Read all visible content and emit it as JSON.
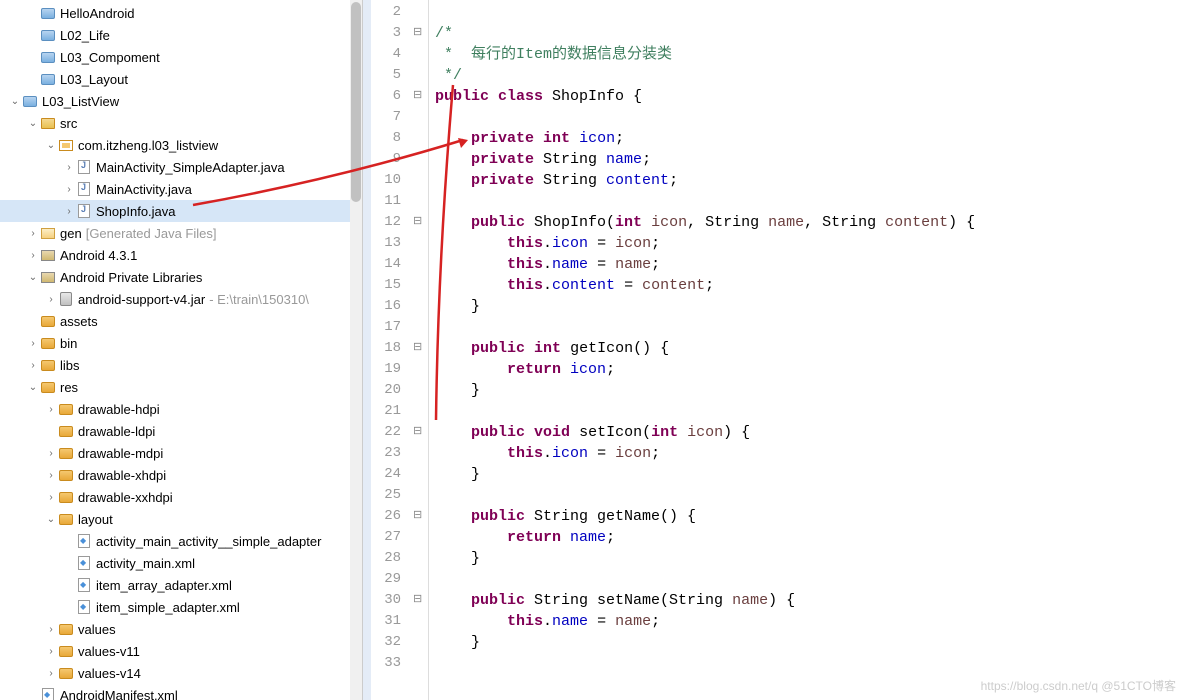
{
  "tree": {
    "items": [
      {
        "indent": 1,
        "arrow": "none",
        "icon": "ic-folder-blue",
        "label": "HelloAndroid"
      },
      {
        "indent": 1,
        "arrow": "none",
        "icon": "ic-folder-blue",
        "label": "L02_Life"
      },
      {
        "indent": 1,
        "arrow": "none",
        "icon": "ic-folder-blue",
        "label": "L03_Compoment"
      },
      {
        "indent": 1,
        "arrow": "none",
        "icon": "ic-folder-blue",
        "label": "L03_Layout"
      },
      {
        "indent": 0,
        "arrow": "open",
        "icon": "ic-folder-blue",
        "label": "L03_ListView"
      },
      {
        "indent": 1,
        "arrow": "open",
        "icon": "ic-src",
        "label": "src"
      },
      {
        "indent": 2,
        "arrow": "open",
        "icon": "ic-pkg",
        "label": "com.itzheng.l03_listview"
      },
      {
        "indent": 3,
        "arrow": "closed",
        "icon": "ic-java",
        "label": "MainActivity_SimpleAdapter.java"
      },
      {
        "indent": 3,
        "arrow": "closed",
        "icon": "ic-java",
        "label": "MainActivity.java"
      },
      {
        "indent": 3,
        "arrow": "closed",
        "icon": "ic-java",
        "label": "ShopInfo.java",
        "selected": true
      },
      {
        "indent": 1,
        "arrow": "closed",
        "icon": "ic-gen",
        "label": "gen",
        "extra": "[Generated Java Files]",
        "extraColor": "gray"
      },
      {
        "indent": 1,
        "arrow": "closed",
        "icon": "ic-lib",
        "label": "Android 4.3.1"
      },
      {
        "indent": 1,
        "arrow": "open",
        "icon": "ic-lib",
        "label": "Android Private Libraries"
      },
      {
        "indent": 2,
        "arrow": "closed",
        "icon": "ic-jar",
        "label": "android-support-v4.jar",
        "extra": " - E:\\train\\150310\\",
        "extraGray": true
      },
      {
        "indent": 1,
        "arrow": "none",
        "icon": "ic-folder",
        "label": "assets"
      },
      {
        "indent": 1,
        "arrow": "closed",
        "icon": "ic-folder",
        "label": "bin"
      },
      {
        "indent": 1,
        "arrow": "closed",
        "icon": "ic-folder",
        "label": "libs"
      },
      {
        "indent": 1,
        "arrow": "open",
        "icon": "ic-folder",
        "label": "res"
      },
      {
        "indent": 2,
        "arrow": "closed",
        "icon": "ic-folder",
        "label": "drawable-hdpi"
      },
      {
        "indent": 2,
        "arrow": "none",
        "icon": "ic-folder",
        "label": "drawable-ldpi"
      },
      {
        "indent": 2,
        "arrow": "closed",
        "icon": "ic-folder",
        "label": "drawable-mdpi"
      },
      {
        "indent": 2,
        "arrow": "closed",
        "icon": "ic-folder",
        "label": "drawable-xhdpi"
      },
      {
        "indent": 2,
        "arrow": "closed",
        "icon": "ic-folder",
        "label": "drawable-xxhdpi"
      },
      {
        "indent": 2,
        "arrow": "open",
        "icon": "ic-folder",
        "label": "layout"
      },
      {
        "indent": 3,
        "arrow": "none",
        "icon": "ic-xml",
        "label": "activity_main_activity__simple_adapter"
      },
      {
        "indent": 3,
        "arrow": "none",
        "icon": "ic-xml",
        "label": "activity_main.xml"
      },
      {
        "indent": 3,
        "arrow": "none",
        "icon": "ic-xml",
        "label": "item_array_adapter.xml"
      },
      {
        "indent": 3,
        "arrow": "none",
        "icon": "ic-xml",
        "label": "item_simple_adapter.xml"
      },
      {
        "indent": 2,
        "arrow": "closed",
        "icon": "ic-folder",
        "label": "values"
      },
      {
        "indent": 2,
        "arrow": "closed",
        "icon": "ic-folder",
        "label": "values-v11"
      },
      {
        "indent": 2,
        "arrow": "closed",
        "icon": "ic-folder",
        "label": "values-v14"
      },
      {
        "indent": 1,
        "arrow": "none",
        "icon": "ic-xml",
        "label": "AndroidManifest.xml"
      }
    ]
  },
  "code": {
    "lines": [
      {
        "n": 2,
        "fold": "",
        "html": ""
      },
      {
        "n": 3,
        "fold": "minus",
        "html": "<span class='cm'>/*</span>"
      },
      {
        "n": 4,
        "fold": "",
        "html": "<span class='cm'> *  每行的Item的数据信息分装类</span>"
      },
      {
        "n": 5,
        "fold": "",
        "html": "<span class='cm'> */</span>"
      },
      {
        "n": 6,
        "fold": "minus",
        "html": "<span class='kw'>public</span> <span class='kw'>class</span> ShopInfo {"
      },
      {
        "n": 7,
        "fold": "",
        "html": ""
      },
      {
        "n": 8,
        "fold": "",
        "html": "    <span class='kw'>private</span> <span class='kw'>int</span> <span class='fieldref'>icon</span>;"
      },
      {
        "n": 9,
        "fold": "",
        "html": "    <span class='kw'>private</span> String <span class='fieldref'>name</span>;"
      },
      {
        "n": 10,
        "fold": "",
        "html": "    <span class='kw'>private</span> String <span class='fieldref'>content</span>;"
      },
      {
        "n": 11,
        "fold": "",
        "html": ""
      },
      {
        "n": 12,
        "fold": "minus",
        "html": "    <span class='kw'>public</span> ShopInfo(<span class='kw'>int</span> <span class='varref'>icon</span>, String <span class='varref'>name</span>, String <span class='varref'>content</span>) {"
      },
      {
        "n": 13,
        "fold": "",
        "html": "        <span class='kw'>this</span>.<span class='fieldref'>icon</span> = <span class='varref'>icon</span>;"
      },
      {
        "n": 14,
        "fold": "",
        "html": "        <span class='kw'>this</span>.<span class='fieldref'>name</span> = <span class='varref'>name</span>;"
      },
      {
        "n": 15,
        "fold": "",
        "html": "        <span class='kw'>this</span>.<span class='fieldref'>content</span> = <span class='varref'>content</span>;"
      },
      {
        "n": 16,
        "fold": "",
        "html": "    }"
      },
      {
        "n": 17,
        "fold": "",
        "html": ""
      },
      {
        "n": 18,
        "fold": "minus",
        "html": "    <span class='kw'>public</span> <span class='kw'>int</span> getIcon() {"
      },
      {
        "n": 19,
        "fold": "",
        "html": "        <span class='kw'>return</span> <span class='fieldref'>icon</span>;"
      },
      {
        "n": 20,
        "fold": "",
        "html": "    }"
      },
      {
        "n": 21,
        "fold": "",
        "html": ""
      },
      {
        "n": 22,
        "fold": "minus",
        "html": "    <span class='kw'>public</span> <span class='kw'>void</span> setIcon(<span class='kw'>int</span> <span class='varref'>icon</span>) {"
      },
      {
        "n": 23,
        "fold": "",
        "html": "        <span class='kw'>this</span>.<span class='fieldref'>icon</span> = <span class='varref'>icon</span>;"
      },
      {
        "n": 24,
        "fold": "",
        "html": "    }"
      },
      {
        "n": 25,
        "fold": "",
        "html": ""
      },
      {
        "n": 26,
        "fold": "minus",
        "html": "    <span class='kw'>public</span> String getName() {"
      },
      {
        "n": 27,
        "fold": "",
        "html": "        <span class='kw'>return</span> <span class='fieldref'>name</span>;"
      },
      {
        "n": 28,
        "fold": "",
        "html": "    }"
      },
      {
        "n": 29,
        "fold": "",
        "html": ""
      },
      {
        "n": 30,
        "fold": "minus",
        "html": "    <span class='kw'>public</span> String setName(String <span class='varref'>name</span>) {"
      },
      {
        "n": 31,
        "fold": "",
        "html": "        <span class='kw'>this</span>.<span class='fieldref'>name</span> = <span class='varref'>name</span>;"
      },
      {
        "n": 32,
        "fold": "",
        "html": "    }"
      },
      {
        "n": 33,
        "fold": "",
        "html": ""
      }
    ]
  },
  "watermark": "https://blog.csdn.net/q @51CTO博客"
}
